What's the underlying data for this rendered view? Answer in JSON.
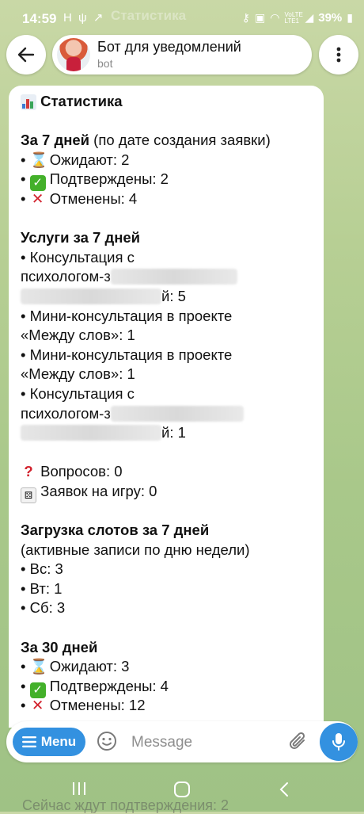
{
  "status_bar": {
    "time": "14:59",
    "left_icons": "H ψ ↗",
    "ghost_title": "Статистика",
    "network": "VoLTE LTE1",
    "battery": "39%"
  },
  "header": {
    "title": "Бот для уведомлений",
    "subtitle": "bot"
  },
  "message": {
    "title": "Статистика",
    "week": {
      "heading": "За 7 дней",
      "heading_note": " (по дате создания заявки)",
      "pending": "Ожидают: 2",
      "confirmed": "Подтверждены: 2",
      "cancelled": "Отменены: 4"
    },
    "services": {
      "heading": "Услуги за 7 дней",
      "items": [
        {
          "line1": "• Консультация с",
          "line2": "психологом-з",
          "line3_end": "й: 5"
        },
        {
          "line1": "• Мини-консультация в проекте",
          "line2": "«Между слов»: 1"
        },
        {
          "line1": "• Мини-консультация в проекте",
          "line2": "«Между слов»: 1"
        },
        {
          "line1": "• Консультация с",
          "line2": "психологом-з",
          "line3_end": "й: 1"
        }
      ]
    },
    "questions": "Вопросов: 0",
    "game_requests": "Заявок на игру: 0",
    "slots": {
      "heading": "Загрузка слотов за 7 дней",
      "note": "(активные записи по дню недели)",
      "days": [
        "• Вс: 3",
        "• Вт: 1",
        "• Сб: 3"
      ]
    },
    "month": {
      "heading": "За 30 дней",
      "pending": "Ожидают: 3",
      "confirmed": "Подтверждены: 4",
      "cancelled": "Отменены: 12"
    }
  },
  "input": {
    "menu_label": "Menu",
    "placeholder": "Message"
  },
  "ghost_footer": "Сейчас ждут подтверждения: 2",
  "colors": {
    "accent": "#3391e0",
    "background": "#b7cf94"
  },
  "icons": [
    "back-arrow-icon",
    "more-vertical-icon",
    "hamburger-icon",
    "smile-icon",
    "paperclip-icon",
    "microphone-icon",
    "hourglass-icon",
    "check-icon",
    "cross-icon",
    "question-icon",
    "dice-icon",
    "chart-icon"
  ]
}
